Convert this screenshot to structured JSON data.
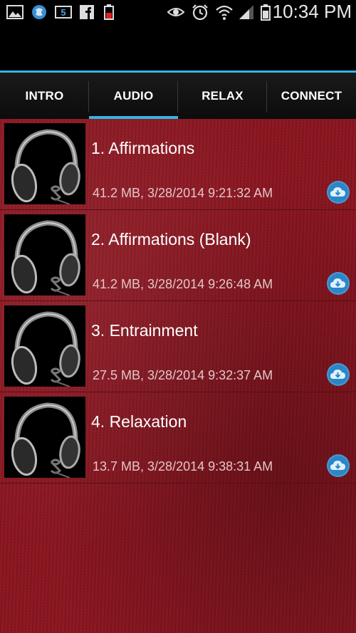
{
  "status_bar": {
    "time": "10:34 PM",
    "icons": [
      "gallery-icon",
      "browser-icon",
      "five-badge-icon",
      "facebook-icon",
      "battery-alert-icon",
      "eye-icon",
      "alarm-icon",
      "wifi-icon",
      "signal-icon",
      "battery-icon"
    ]
  },
  "tabs": [
    {
      "label": "INTRO",
      "selected": false
    },
    {
      "label": "AUDIO",
      "selected": true
    },
    {
      "label": "RELAX",
      "selected": false
    },
    {
      "label": "CONNECT",
      "selected": false
    }
  ],
  "tracks": [
    {
      "title": "1. Affirmations",
      "meta": "41.2 MB, 3/28/2014 9:21:32 AM",
      "thumb_icon": "headphones-icon",
      "action_icon": "cloud-download-icon"
    },
    {
      "title": "2. Affirmations (Blank)",
      "meta": "41.2 MB, 3/28/2014 9:26:48 AM",
      "thumb_icon": "headphones-icon",
      "action_icon": "cloud-download-icon"
    },
    {
      "title": "3. Entrainment",
      "meta": "27.5 MB, 3/28/2014 9:32:37 AM",
      "thumb_icon": "headphones-icon",
      "action_icon": "cloud-download-icon"
    },
    {
      "title": "4. Relaxation",
      "meta": "13.7 MB, 3/28/2014 9:38:31 AM",
      "thumb_icon": "headphones-icon",
      "action_icon": "cloud-download-icon"
    }
  ],
  "colors": {
    "accent": "#33b5e5",
    "background": "#8c1520",
    "cloud_button": "#2b86c8"
  }
}
